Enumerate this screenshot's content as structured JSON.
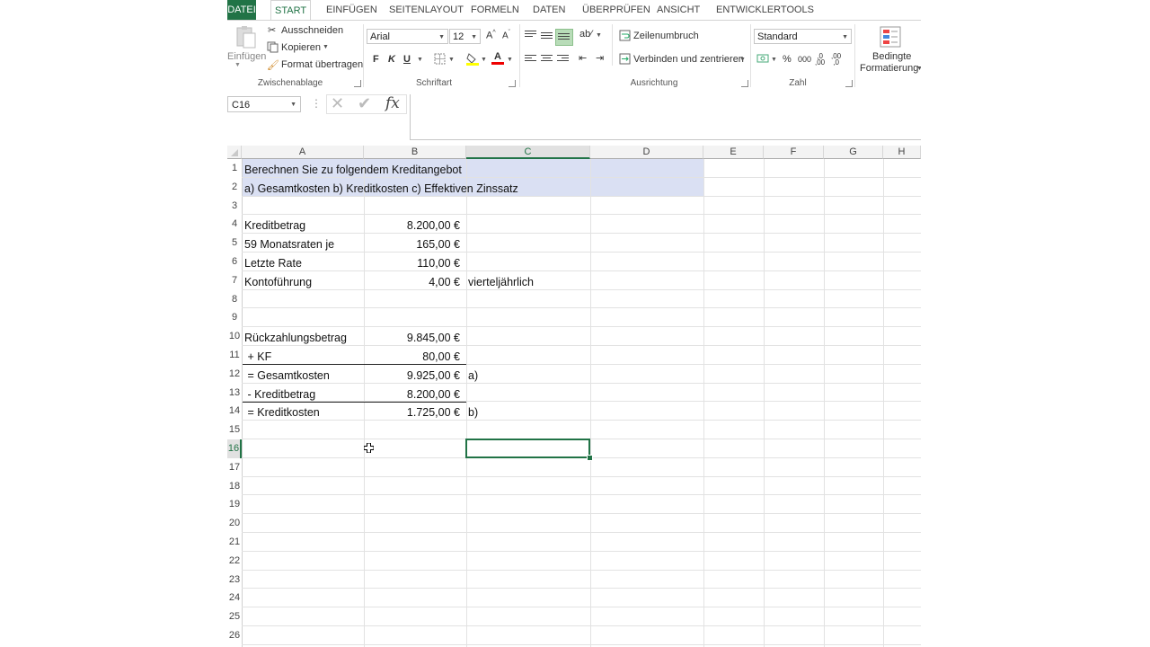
{
  "ribbon_tabs": [
    "DATEI",
    "START",
    "EINFÜGEN",
    "SEITENLAYOUT",
    "FORMELN",
    "DATEN",
    "ÜBERPRÜFEN",
    "ANSICHT",
    "ENTWICKLERTOOLS"
  ],
  "clipboard": {
    "paste": "Einfügen",
    "cut": "Ausschneiden",
    "copy": "Kopieren",
    "format_painter": "Format übertragen",
    "group": "Zwischenablage"
  },
  "font": {
    "name": "Arial",
    "size": "12",
    "bold": "F",
    "italic": "K",
    "underline": "U",
    "group": "Schriftart"
  },
  "alignment": {
    "wrap": "Zeilenumbruch",
    "merge": "Verbinden und zentrieren",
    "group": "Ausrichtung"
  },
  "number": {
    "format": "Standard",
    "percent": "%",
    "thousands": "000",
    "group": "Zahl"
  },
  "styles": {
    "conditional_line1": "Bedingte",
    "conditional_line2": "Formatierung"
  },
  "formula_bar": {
    "name_box": "C16",
    "fx": "fx",
    "content": ""
  },
  "columns": [
    "A",
    "B",
    "C",
    "D",
    "E",
    "F",
    "G",
    "H"
  ],
  "selected_column": "C",
  "rows": [
    "1",
    "2",
    "3",
    "4",
    "5",
    "6",
    "7",
    "8",
    "9",
    "10",
    "11",
    "12",
    "13",
    "14",
    "15",
    "16",
    "17",
    "18",
    "19",
    "20",
    "21",
    "22",
    "23",
    "24",
    "25",
    "26"
  ],
  "selected_row": "16",
  "cells": {
    "A1": "Berechnen Sie zu folgendem Kreditangebot",
    "A2": "a) Gesamtkosten b) Kreditkosten  c) Effektiven Zinssatz",
    "A4": "Kreditbetrag",
    "B4": "8.200,00 €",
    "A5": "59 Monatsraten je",
    "B5": "165,00 €",
    "A6": "Letzte Rate",
    "B6": "110,00 €",
    "A7": "Kontoführung",
    "B7": "4,00 €",
    "C7": "vierteljährlich",
    "A10": "Rückzahlungsbetrag",
    "B10": "9.845,00 €",
    "A11": " + KF",
    "B11": "80,00 €",
    "A12": " = Gesamtkosten",
    "B12": "9.925,00 €",
    "C12": "a)",
    "A13": " - Kreditbetrag",
    "B13": "8.200,00 €",
    "A14": " = Kreditkosten",
    "B14": "1.725,00 €",
    "C14": "b)"
  },
  "colors": {
    "accent": "#217346",
    "highlight_fill": "#dae0f3"
  }
}
